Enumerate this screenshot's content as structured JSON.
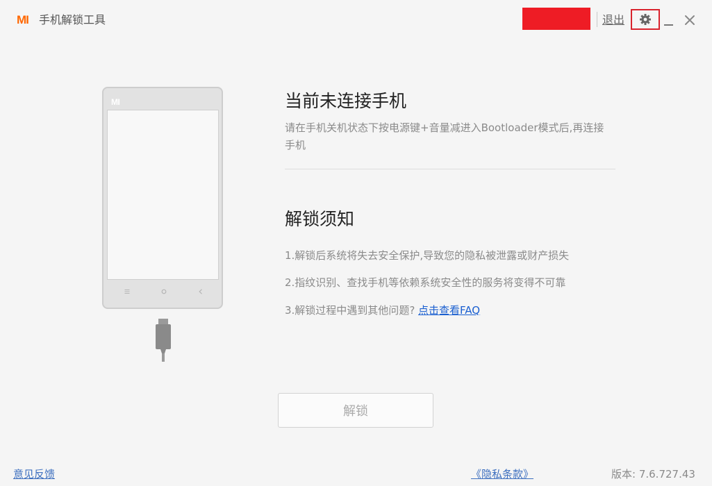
{
  "window": {
    "logo_text": "MI",
    "title": "手机解锁工具",
    "logout_label": "退出",
    "settings_icon": "gear-icon",
    "minimize_icon": "minimize-icon",
    "close_icon": "close-icon",
    "user_block_color": "#ee1c25",
    "accent_color": "#ff6700"
  },
  "phone": {
    "brand_text": "MI",
    "nav_keys": [
      "menu-icon",
      "home-icon",
      "back-icon"
    ]
  },
  "status": {
    "heading": "当前未连接手机",
    "description": "请在手机关机状态下按电源键+音量减进入Bootloader模式后,再连接手机"
  },
  "notice": {
    "heading": "解锁须知",
    "item1": "1.解锁后系统将失去安全保护,导致您的隐私被泄露或财产损失",
    "item2": "2.指纹识别、查找手机等依赖系统安全性的服务将变得不可靠",
    "item3_prefix": "3.解锁过程中遇到其他问题? ",
    "item3_link": "点击查看FAQ",
    "link_color": "#1a5fd0"
  },
  "actions": {
    "unlock_label": "解锁"
  },
  "footer": {
    "feedback_label": "意见反馈",
    "privacy_label": "《隐私条款》",
    "version_label": "版本: 7.6.727.43"
  }
}
